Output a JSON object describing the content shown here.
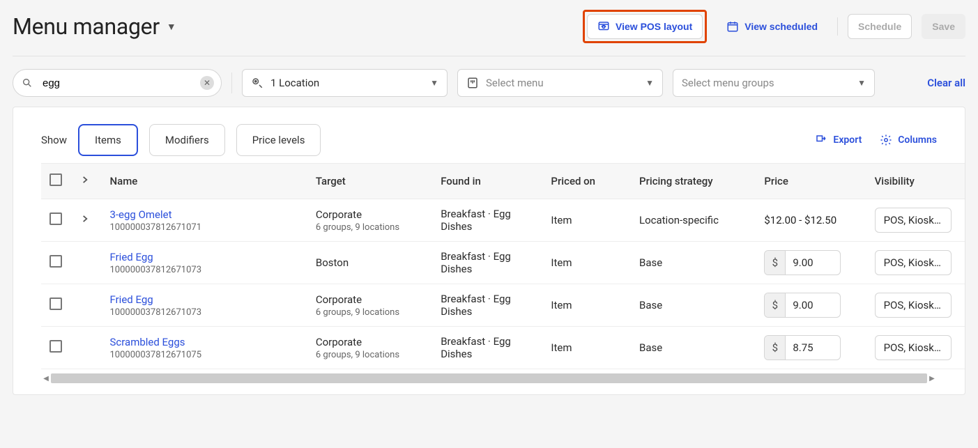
{
  "header": {
    "title": "Menu manager",
    "view_pos_layout": "View POS layout",
    "view_scheduled": "View scheduled",
    "schedule": "Schedule",
    "save": "Save"
  },
  "filters": {
    "search_value": "egg",
    "location_label": "1 Location",
    "select_menu_placeholder": "Select menu",
    "select_menu_groups_placeholder": "Select menu groups",
    "clear_all": "Clear all"
  },
  "card": {
    "show_label": "Show",
    "tabs": {
      "items": "Items",
      "modifiers": "Modifiers",
      "price_levels": "Price levels"
    },
    "export_label": "Export",
    "columns_label": "Columns"
  },
  "columns": {
    "name": "Name",
    "target": "Target",
    "found_in": "Found in",
    "priced_on": "Priced on",
    "pricing_strategy": "Pricing strategy",
    "price": "Price",
    "visibility": "Visibility"
  },
  "price_currency": "$",
  "rows": [
    {
      "name": "3-egg Omelet",
      "id": "100000037812671071",
      "target": "Corporate",
      "target_sub": "6 groups, 9 locations",
      "found_in": "Breakfast · Egg Dishes",
      "priced_on": "Item",
      "strategy": "Location-specific",
      "price_range": "$12.00 - $12.50",
      "price_value": "",
      "visibility": "POS, Kiosk, T",
      "expandable": true
    },
    {
      "name": "Fried Egg",
      "id": "100000037812671073",
      "target": "Boston",
      "target_sub": "",
      "found_in": "Breakfast · Egg Dishes",
      "priced_on": "Item",
      "strategy": "Base",
      "price_range": "",
      "price_value": "9.00",
      "visibility": "POS, Kiosk, T",
      "expandable": false
    },
    {
      "name": "Fried Egg",
      "id": "100000037812671073",
      "target": "Corporate",
      "target_sub": "6 groups, 9 locations",
      "found_in": "Breakfast · Egg Dishes",
      "priced_on": "Item",
      "strategy": "Base",
      "price_range": "",
      "price_value": "9.00",
      "visibility": "POS, Kiosk, T",
      "expandable": false
    },
    {
      "name": "Scrambled Eggs",
      "id": "100000037812671075",
      "target": "Corporate",
      "target_sub": "6 groups, 9 locations",
      "found_in": "Breakfast · Egg Dishes",
      "priced_on": "Item",
      "strategy": "Base",
      "price_range": "",
      "price_value": "8.75",
      "visibility": "POS, Kiosk, T",
      "expandable": false
    }
  ]
}
